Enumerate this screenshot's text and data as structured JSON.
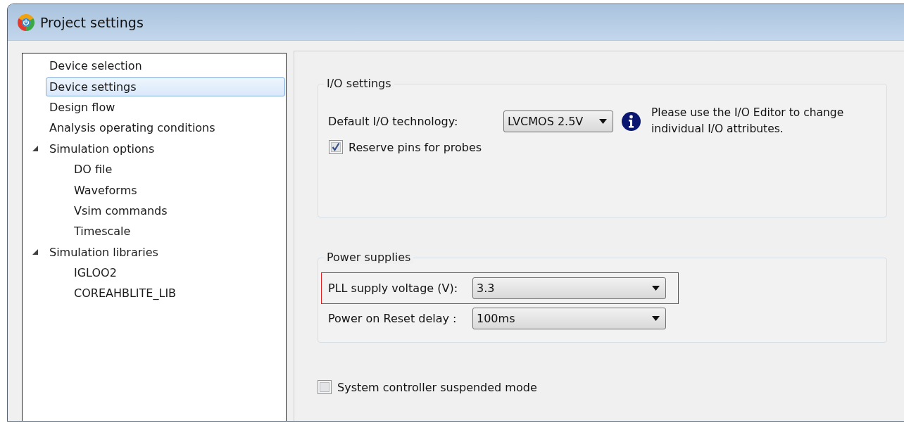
{
  "window": {
    "title": "Project settings"
  },
  "tree": {
    "items": [
      {
        "label": "Device selection",
        "selected": false
      },
      {
        "label": "Device settings",
        "selected": true
      },
      {
        "label": "Design flow",
        "selected": false
      },
      {
        "label": "Analysis operating conditions",
        "selected": false
      },
      {
        "label": "Simulation options",
        "selected": false,
        "expanded": true,
        "children": [
          {
            "label": "DO file",
            "selected": false
          },
          {
            "label": "Waveforms",
            "selected": false
          },
          {
            "label": "Vsim commands",
            "selected": false
          },
          {
            "label": "Timescale",
            "selected": false
          }
        ]
      },
      {
        "label": "Simulation libraries",
        "selected": false,
        "expanded": true,
        "children": [
          {
            "label": "IGLOO2",
            "selected": false
          },
          {
            "label": "COREAHBLITE_LIB",
            "selected": false
          }
        ]
      }
    ]
  },
  "io_settings": {
    "title": "I/O settings",
    "fields": [
      {
        "label": "Default I/O technology:",
        "value": "LVCMOS 2.5V"
      }
    ],
    "note": "Please use the I/O Editor to change individual I/O attributes.",
    "options": [
      {
        "label": "Reserve pins for probes",
        "checked": true
      }
    ]
  },
  "power_supplies": {
    "title": "Power supplies",
    "fields": [
      {
        "label": "PLL supply voltage (V):",
        "value": "3.3",
        "highlighted": true
      },
      {
        "label": "Power on Reset delay :",
        "value": "100ms",
        "highlighted": false
      }
    ]
  },
  "options": [
    {
      "label": "System controller suspended mode",
      "checked": false
    }
  ]
}
